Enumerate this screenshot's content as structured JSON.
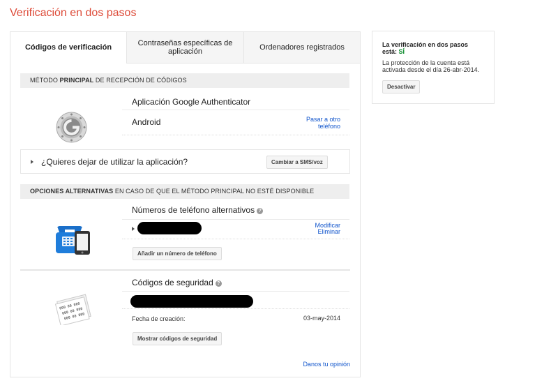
{
  "page": {
    "title": "Verificación en dos pasos"
  },
  "tabs": [
    {
      "label": "Códigos de verificación"
    },
    {
      "label": "Contraseñas específicas de aplicación"
    },
    {
      "label": "Ordenadores registrados"
    }
  ],
  "primary": {
    "header_pre": "MÉTODO ",
    "header_bold": "PRINCIPAL",
    "header_post": " DE RECEPCIÓN DE CÓDIGOS",
    "app_title": "Aplicación Google Authenticator",
    "device": "Android",
    "change_phone_link": "Pasar a otro teléfono",
    "stop_question": "¿Quieres dejar de utilizar la aplicación?",
    "switch_button": "Cambiar a SMS/voz"
  },
  "alternatives": {
    "header_bold": "OPCIONES ALTERNATIVAS",
    "header_post": " EN CASO DE QUE EL MÉTODO PRINCIPAL NO ESTÉ DISPONIBLE",
    "phones_title": "Números de teléfono alternativos",
    "modify_link": "Modificar",
    "delete_link": "Eliminar",
    "add_phone_button": "Añadir un número de teléfono",
    "codes_title": "Códigos de seguridad",
    "creation_label": "Fecha de creación:",
    "creation_date": "03-may-2014",
    "show_codes_button": "Mostrar códigos de seguridad",
    "codes_image_text": "000 00 000"
  },
  "feedback_link": "Danos tu opinión",
  "status_card": {
    "title": "La verificación en dos pasos está:",
    "status": "SÍ",
    "description": "La protección de la cuenta está activada desde el día 26-abr-2014.",
    "disable_button": "Desactivar"
  },
  "icons": [
    "google-authenticator-icon",
    "phone-icon",
    "security-codes-icon",
    "help-icon",
    "expand-arrow-icon"
  ],
  "colors": {
    "title": "#dd4b39",
    "link": "#1155cc",
    "status_on": "#0a8a2a"
  }
}
